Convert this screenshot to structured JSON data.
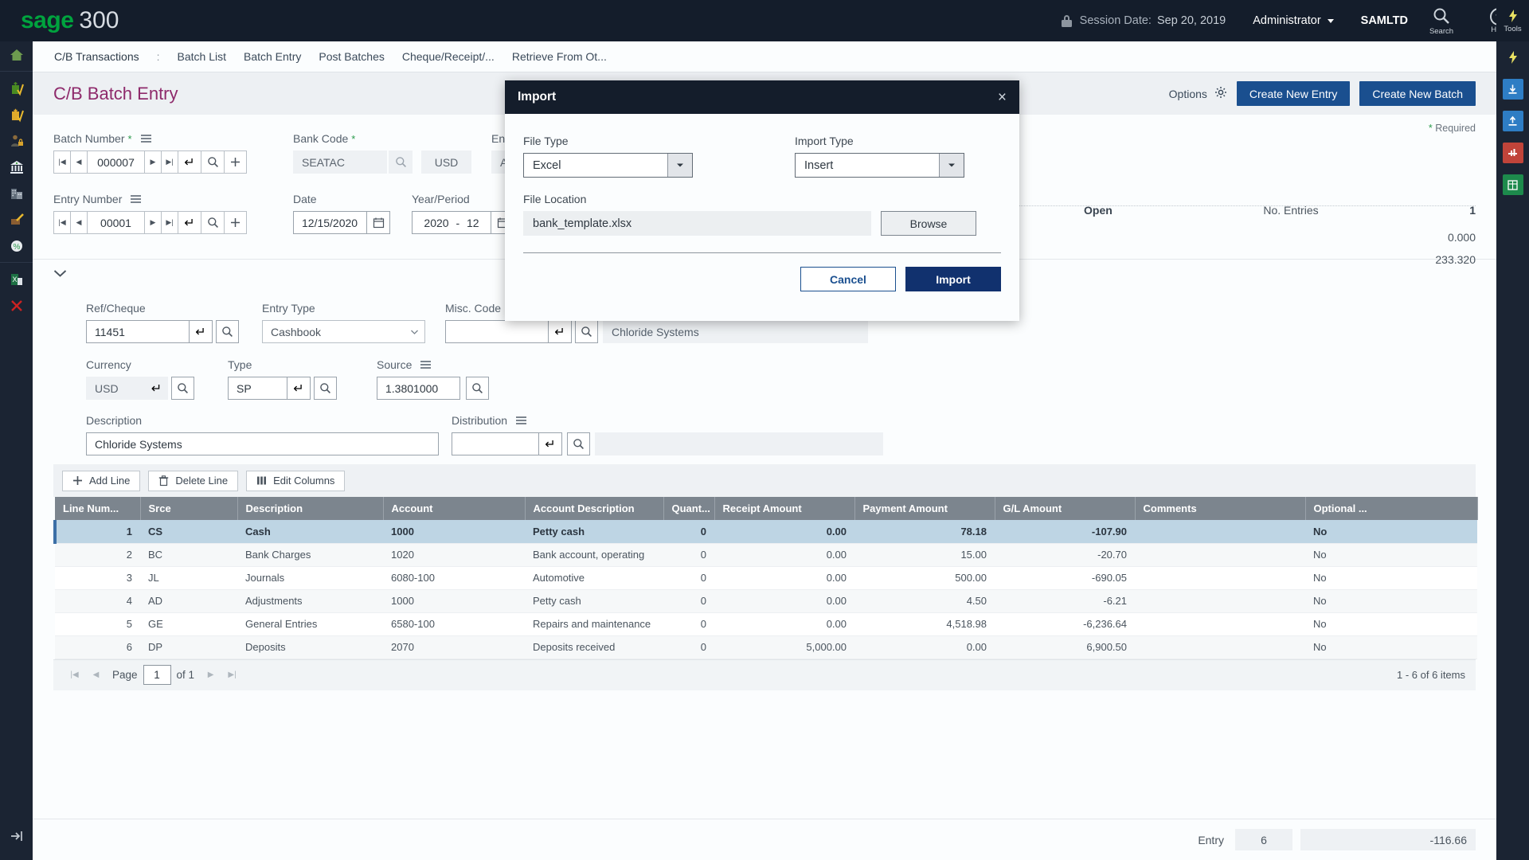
{
  "brand": {
    "name_green": "sage",
    "name_light": "300"
  },
  "topbar": {
    "session_label": "Session Date:",
    "session_date": "Sep 20, 2019",
    "user": "Administrator",
    "company": "SAMLTD",
    "search_label": "Search",
    "help_label": "Help",
    "tools_label": "Tools",
    "lock_icon": "lock-icon"
  },
  "breadcrumb": {
    "root": "C/B Transactions",
    "separator": ":",
    "items": [
      "Batch List",
      "Batch Entry",
      "Post Batches",
      "Cheque/Receipt/...",
      "Retrieve From Ot..."
    ]
  },
  "page": {
    "title": "C/B Batch Entry",
    "options_label": "Options",
    "create_new_entry": "Create New Entry",
    "create_new_batch": "Create New Batch",
    "required_note": "* Required"
  },
  "header_fields": {
    "batch_number": {
      "label": "Batch Number",
      "required": "*",
      "value": "000007"
    },
    "bank_code": {
      "label": "Bank Code",
      "required": "*",
      "value": "SEATAC",
      "currency": "USD"
    },
    "entered_by": {
      "label": "Entered B",
      "value": "ADMIN"
    },
    "entry_number": {
      "label": "Entry Number",
      "value": "00001"
    },
    "date": {
      "label": "Date",
      "value": "12/15/2020"
    },
    "year_period": {
      "label": "Year/Period",
      "year": "2020",
      "dash": "-",
      "period": "12"
    },
    "status_label": "Open",
    "entries_label": "No. Entries",
    "entries_value": "1",
    "amount_1": "0.000",
    "amount_2": "233.320"
  },
  "detail_fields": {
    "ref_cheque": {
      "label": "Ref/Cheque",
      "value": "11451"
    },
    "entry_type": {
      "label": "Entry Type",
      "value": "Cashbook"
    },
    "misc_code": {
      "label": "Misc. Code",
      "value": "",
      "description": "Chloride Systems"
    },
    "currency": {
      "label": "Currency",
      "value": "USD"
    },
    "type": {
      "label": "Type",
      "value": "SP"
    },
    "source": {
      "label": "Source",
      "value": "1.3801000"
    },
    "description": {
      "label": "Description",
      "value": "Chloride Systems"
    },
    "distribution": {
      "label": "Distribution",
      "value": ""
    }
  },
  "grid_toolbar": {
    "add_line": "Add Line",
    "delete_line": "Delete Line",
    "edit_columns": "Edit Columns"
  },
  "grid": {
    "columns": [
      "Line Num...",
      "Srce",
      "Description",
      "Account",
      "Account Description",
      "Quant...",
      "Receipt Amount",
      "Payment Amount",
      "G/L Amount",
      "Comments",
      "Optional ..."
    ],
    "rows": [
      {
        "line": "1",
        "srce": "CS",
        "description": "Cash",
        "account": "1000",
        "account_description": "Petty cash",
        "quantity": "0",
        "receipt": "0.00",
        "payment": "78.18",
        "gl_amount": "-107.90",
        "gl_negative": true,
        "comments": "",
        "optional": "No"
      },
      {
        "line": "2",
        "srce": "BC",
        "description": "Bank Charges",
        "account": "1020",
        "account_description": "Bank account, operating",
        "quantity": "0",
        "receipt": "0.00",
        "payment": "15.00",
        "gl_amount": "-20.70",
        "gl_negative": true,
        "comments": "",
        "optional": "No"
      },
      {
        "line": "3",
        "srce": "JL",
        "description": "Journals",
        "account": "6080-100",
        "account_description": "Automotive",
        "quantity": "0",
        "receipt": "0.00",
        "payment": "500.00",
        "gl_amount": "-690.05",
        "gl_negative": true,
        "comments": "",
        "optional": "No"
      },
      {
        "line": "4",
        "srce": "AD",
        "description": "Adjustments",
        "account": "1000",
        "account_description": "Petty cash",
        "quantity": "0",
        "receipt": "0.00",
        "payment": "4.50",
        "gl_amount": "-6.21",
        "gl_negative": true,
        "comments": "",
        "optional": "No"
      },
      {
        "line": "5",
        "srce": "GE",
        "description": "General Entries",
        "account": "6580-100",
        "account_description": "Repairs and maintenance",
        "quantity": "0",
        "receipt": "0.00",
        "payment": "4,518.98",
        "gl_amount": "-6,236.64",
        "gl_negative": true,
        "comments": "",
        "optional": "No"
      },
      {
        "line": "6",
        "srce": "DP",
        "description": "Deposits",
        "account": "2070",
        "account_description": "Deposits received",
        "quantity": "0",
        "receipt": "5,000.00",
        "payment": "0.00",
        "gl_amount": "6,900.50",
        "gl_negative": false,
        "comments": "",
        "optional": "No"
      }
    ],
    "selected_row_index": 0
  },
  "pagination": {
    "page_label": "Page",
    "page_value": "1",
    "of_label": "of 1",
    "item_count": "1 - 6 of 6 items"
  },
  "bottom": {
    "entry_label": "Entry",
    "entry_count": "6",
    "entry_total": "-116.66"
  },
  "modal": {
    "title": "Import",
    "close_icon": "close-icon",
    "file_type_label": "File Type",
    "file_type_value": "Excel",
    "import_type_label": "Import Type",
    "import_type_value": "Insert",
    "file_location_label": "File Location",
    "file_location_value": "bank_template.xlsx",
    "browse_label": "Browse",
    "cancel_label": "Cancel",
    "import_label": "Import"
  },
  "colors": {
    "topbar": "#141d2b",
    "accent_blue": "#1a4f8f",
    "title_purple": "#8e2a6b",
    "negative_red": "#d14343",
    "sage_green": "#00a33e",
    "selected_row": "#bed5e4"
  }
}
